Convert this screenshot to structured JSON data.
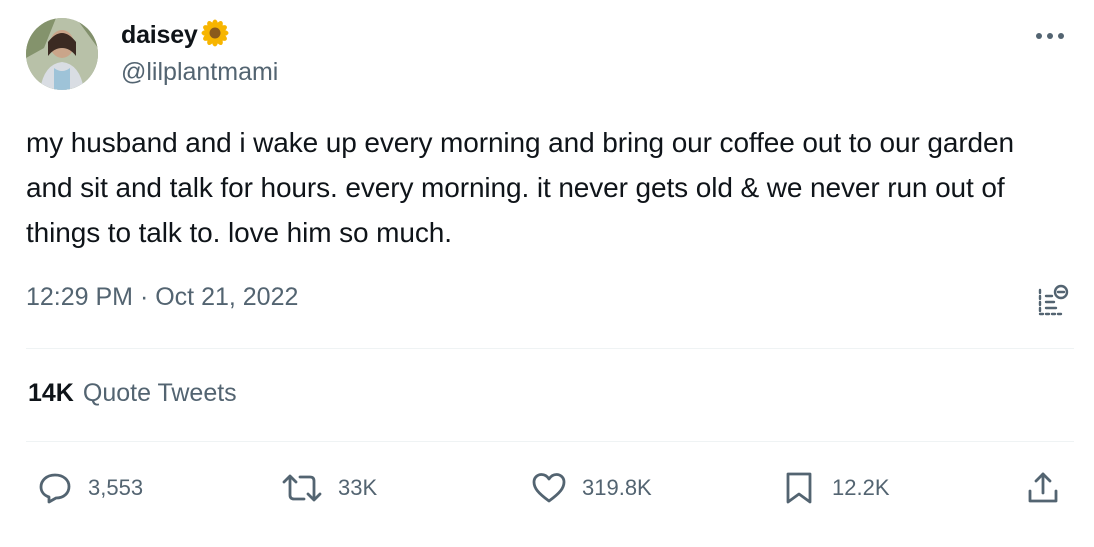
{
  "author": {
    "display_name": "daisey",
    "handle": "@lilplantmami",
    "badge_icon": "sunflower-emoji"
  },
  "tweet": {
    "text": "my husband and i wake up every morning and bring our coffee out to our garden and sit and talk for hours. every morning. it never gets old & we never run out of things to talk to. love him so much."
  },
  "meta": {
    "time": "12:29 PM",
    "separator": " · ",
    "date": "Oct 21, 2022"
  },
  "quote_tweets": {
    "count": "14K",
    "label": "Quote Tweets"
  },
  "actions": {
    "replies": "3,553",
    "retweets": "33K",
    "likes": "319.8K",
    "bookmarks": "12.2K"
  },
  "colors": {
    "text": "#0f1419",
    "secondary": "#536471",
    "divider": "#eff3f4"
  }
}
